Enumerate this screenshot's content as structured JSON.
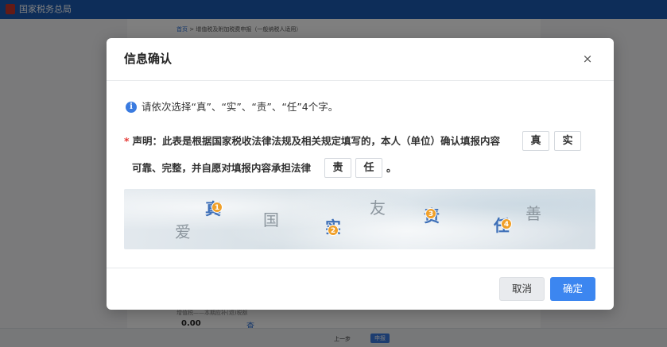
{
  "background": {
    "site_title": "国家税务总局",
    "breadcrumb_home": "首页",
    "breadcrumb_separator": ">",
    "breadcrumb_current": "增值税及附加税费申报（一般纳税人适用）",
    "tax_label": "增值税——本期应补(退)税额",
    "amount": "0.00",
    "amount_link": "查",
    "footer_prev": "上一步",
    "footer_next": "申报"
  },
  "modal": {
    "title": "信息确认",
    "close_label": "×",
    "hint": "请依次选择“真”、“实”、“责”、“任”4个字。",
    "declaration": {
      "required_mark": "*",
      "line1": "声明：此表是根据国家税收法律法规及相关规定填写的，本人（单位）确认填报内容",
      "line2": "可靠、完整，并自愿对填报内容承担法律",
      "ending": "。"
    },
    "slots": [
      "真",
      "实",
      "责",
      "任"
    ],
    "captcha": {
      "characters": [
        {
          "char": "爱",
          "style": "grey"
        },
        {
          "char": "真",
          "style": "blue",
          "marker": "1"
        },
        {
          "char": "国",
          "style": "grey"
        },
        {
          "char": "实",
          "style": "blue",
          "marker": "2"
        },
        {
          "char": "友",
          "style": "grey"
        },
        {
          "char": "责",
          "style": "blue",
          "marker": "3"
        },
        {
          "char": "任",
          "style": "blue",
          "marker": "4"
        },
        {
          "char": "善",
          "style": "grey"
        }
      ]
    },
    "cancel_label": "取消",
    "confirm_label": "确定"
  },
  "colors": {
    "primary": "#3c86f0",
    "header_bar": "#1b5bb3",
    "required": "#e53935",
    "marker": "#f0a02a"
  }
}
